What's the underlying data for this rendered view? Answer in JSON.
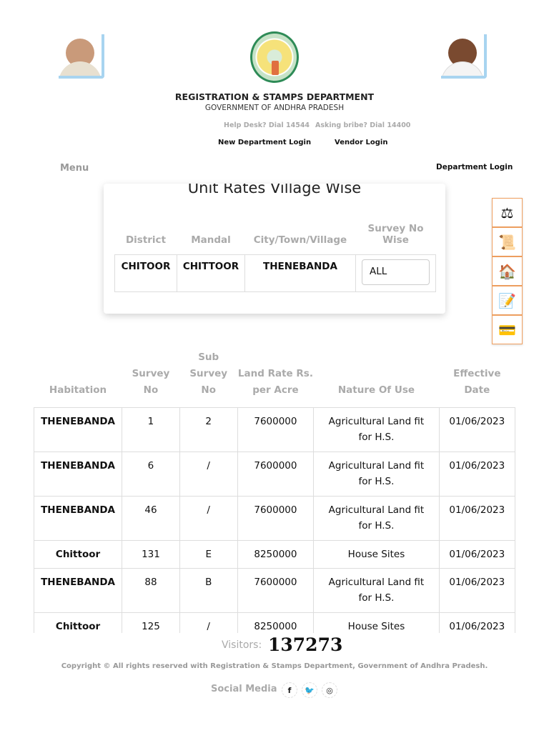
{
  "header": {
    "title": "REGISTRATION & STAMPS DEPARTMENT",
    "subtitle": "GOVERNMENT OF ANDHRA PRADESH",
    "help_desk": "Help Desk? Dial 14544",
    "bribe": "Asking bribe? Dial 14400",
    "new_dept_login": "New Department Login",
    "vendor_login": "Vendor Login",
    "menu": "Menu",
    "dept_login": "Department Login"
  },
  "filter": {
    "title": "Unit Rates Village Wise",
    "headers": [
      "District",
      "Mandal",
      "City/Town/Village",
      "Survey No Wise"
    ],
    "district": "CHITOOR",
    "mandal": "CHITTOOR",
    "village": "THENEBANDA",
    "survey_select": "ALL"
  },
  "table": {
    "headers": [
      "Habitation",
      "Survey No",
      "Sub Survey No",
      "Land Rate Rs. per Acre",
      "Nature Of Use",
      "Effective Date"
    ],
    "rows": [
      [
        "THENEBANDA",
        "1",
        "2",
        "7600000",
        "Agricultural Land fit for H.S.",
        "01/06/2023"
      ],
      [
        "THENEBANDA",
        "6",
        "/",
        "7600000",
        "Agricultural Land fit for H.S.",
        "01/06/2023"
      ],
      [
        "THENEBANDA",
        "46",
        "/",
        "7600000",
        "Agricultural Land fit for H.S.",
        "01/06/2023"
      ],
      [
        "Chittoor",
        "131",
        "E",
        "8250000",
        "House Sites",
        "01/06/2023"
      ],
      [
        "THENEBANDA",
        "88",
        "B",
        "7600000",
        "Agricultural Land fit for H.S.",
        "01/06/2023"
      ],
      [
        "Chittoor",
        "125",
        "/",
        "8250000",
        "House Sites",
        "01/06/2023"
      ]
    ]
  },
  "footer": {
    "visitors_label": "Visitors:",
    "visitors_count": "137273",
    "copyright": "Copyright © All rights reserved with Registration & Stamps Department, Government of Andhra Pradesh.",
    "social_label": "Social Media"
  }
}
